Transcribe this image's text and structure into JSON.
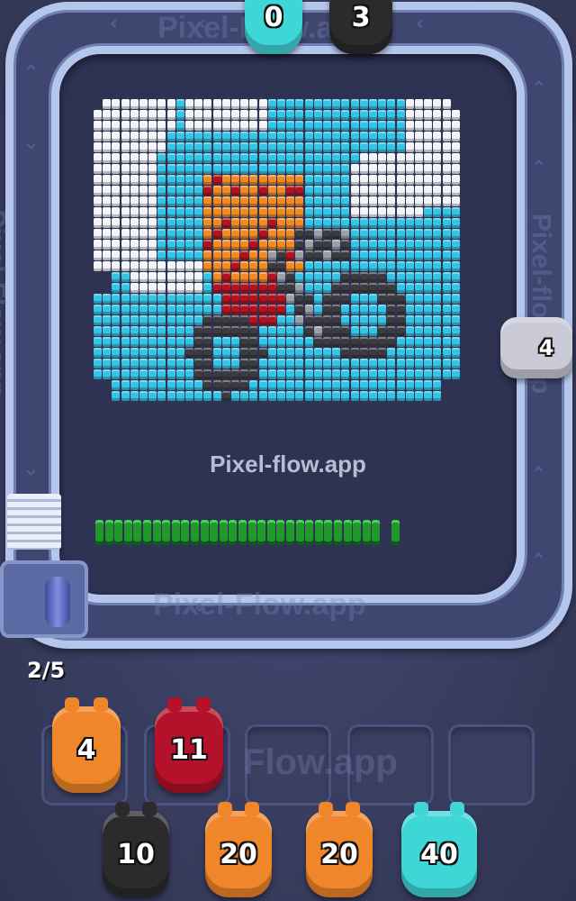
{
  "watermarks": {
    "center": "Pixel-flow.app",
    "top": "Pixel-Flow.app",
    "bottom": "Pixel-Flow.app",
    "left": "Pixel-Flow.app",
    "right": "Pixel-flow.app",
    "slots": "Flow.app"
  },
  "counter": "2/5",
  "top_pigs": [
    {
      "value": "0",
      "color": "#3fd6d6"
    },
    {
      "value": "3",
      "color": "#2b2b2e"
    }
  ],
  "side_pig": {
    "value": "4",
    "color": "#c9cad6"
  },
  "slot_pigs": [
    {
      "value": "4",
      "color": "#f0862a"
    },
    {
      "value": "11",
      "color": "#b3122a"
    }
  ],
  "queue_pigs": [
    {
      "value": "10",
      "color": "#2b2b2e"
    },
    {
      "value": "20",
      "color": "#f0862a"
    },
    {
      "value": "20",
      "color": "#f0862a"
    },
    {
      "value": "40",
      "color": "#3fd6d6"
    }
  ],
  "progress": {
    "filled_fraction": 0.92
  },
  "palette": {
    "sky": "#34c4e6",
    "cloud": "#f2f4f8",
    "orange": "#f08a22",
    "red": "#b3121e",
    "dark": "#3c3c40",
    "grey": "#9aa0aa",
    "green": "#1f9a2a"
  }
}
